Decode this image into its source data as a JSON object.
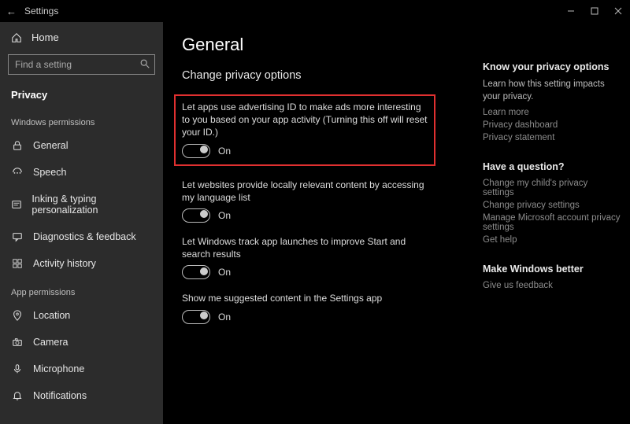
{
  "titlebar": {
    "back": "←",
    "title": "Settings"
  },
  "sidebar": {
    "home": "Home",
    "search_placeholder": "Find a setting",
    "active": "Privacy",
    "group1": "Windows permissions",
    "items1": [
      {
        "label": "General"
      },
      {
        "label": "Speech"
      },
      {
        "label": "Inking & typing personalization"
      },
      {
        "label": "Diagnostics & feedback"
      },
      {
        "label": "Activity history"
      }
    ],
    "group2": "App permissions",
    "items2": [
      {
        "label": "Location"
      },
      {
        "label": "Camera"
      },
      {
        "label": "Microphone"
      },
      {
        "label": "Notifications"
      }
    ]
  },
  "main": {
    "title": "General",
    "section": "Change privacy options",
    "options": [
      {
        "label": "Let apps use advertising ID to make ads more interesting to you based on your app activity (Turning this off will reset your ID.)",
        "state": "On"
      },
      {
        "label": "Let websites provide locally relevant content by accessing my language list",
        "state": "On"
      },
      {
        "label": "Let Windows track app launches to improve Start and search results",
        "state": "On"
      },
      {
        "label": "Show me suggested content in the Settings app",
        "state": "On"
      }
    ]
  },
  "rail": {
    "b1_title": "Know your privacy options",
    "b1_desc": "Learn how this setting impacts your privacy.",
    "b1_links": [
      "Learn more",
      "Privacy dashboard",
      "Privacy statement"
    ],
    "b2_title": "Have a question?",
    "b2_links": [
      "Change my child's privacy settings",
      "Change privacy settings",
      "Manage Microsoft account privacy settings",
      "Get help"
    ],
    "b3_title": "Make Windows better",
    "b3_links": [
      "Give us feedback"
    ]
  }
}
